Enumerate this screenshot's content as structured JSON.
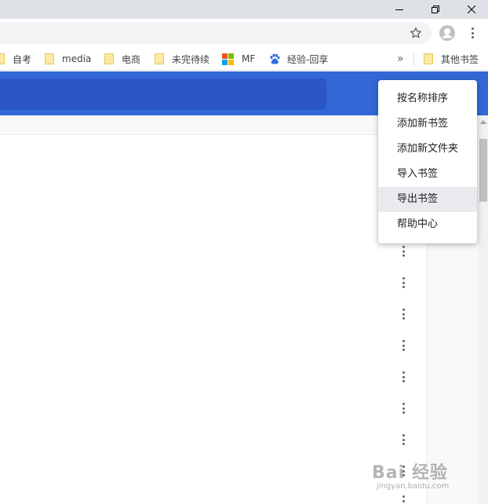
{
  "window": {
    "minimize_icon": "minimize-icon",
    "restore_icon": "restore-icon",
    "close_icon": "close-icon"
  },
  "toolbar": {
    "bookmark_star_icon": "star-icon",
    "profile_icon": "avatar-icon",
    "menu_icon": "vertical-dots-icon"
  },
  "bookmarks": {
    "items": [
      {
        "label": "自考",
        "icon": "folder-icon"
      },
      {
        "label": "media",
        "icon": "folder-icon"
      },
      {
        "label": "电商",
        "icon": "folder-icon"
      },
      {
        "label": "未完待续",
        "icon": "folder-icon"
      },
      {
        "label": "MF",
        "icon": "microsoft-icon"
      },
      {
        "label": "经验-回享",
        "icon": "baidu-paw-icon"
      }
    ],
    "overflow_label": "»",
    "other_bookmarks_label": "其他书签"
  },
  "colors": {
    "header": "#3367d6",
    "search": "#2a56c6",
    "menu_hover": "#e8eaed"
  },
  "dropdown": {
    "items": [
      {
        "label": "按名称排序"
      },
      {
        "label": "添加新书签"
      },
      {
        "label": "添加新文件夹"
      },
      {
        "label": "导入书签"
      },
      {
        "label": "导出书签",
        "hovered": true
      },
      {
        "label": "帮助中心"
      }
    ]
  },
  "watermark": {
    "logo": "Bai 经验",
    "url": "jingyan.baidu.com"
  }
}
